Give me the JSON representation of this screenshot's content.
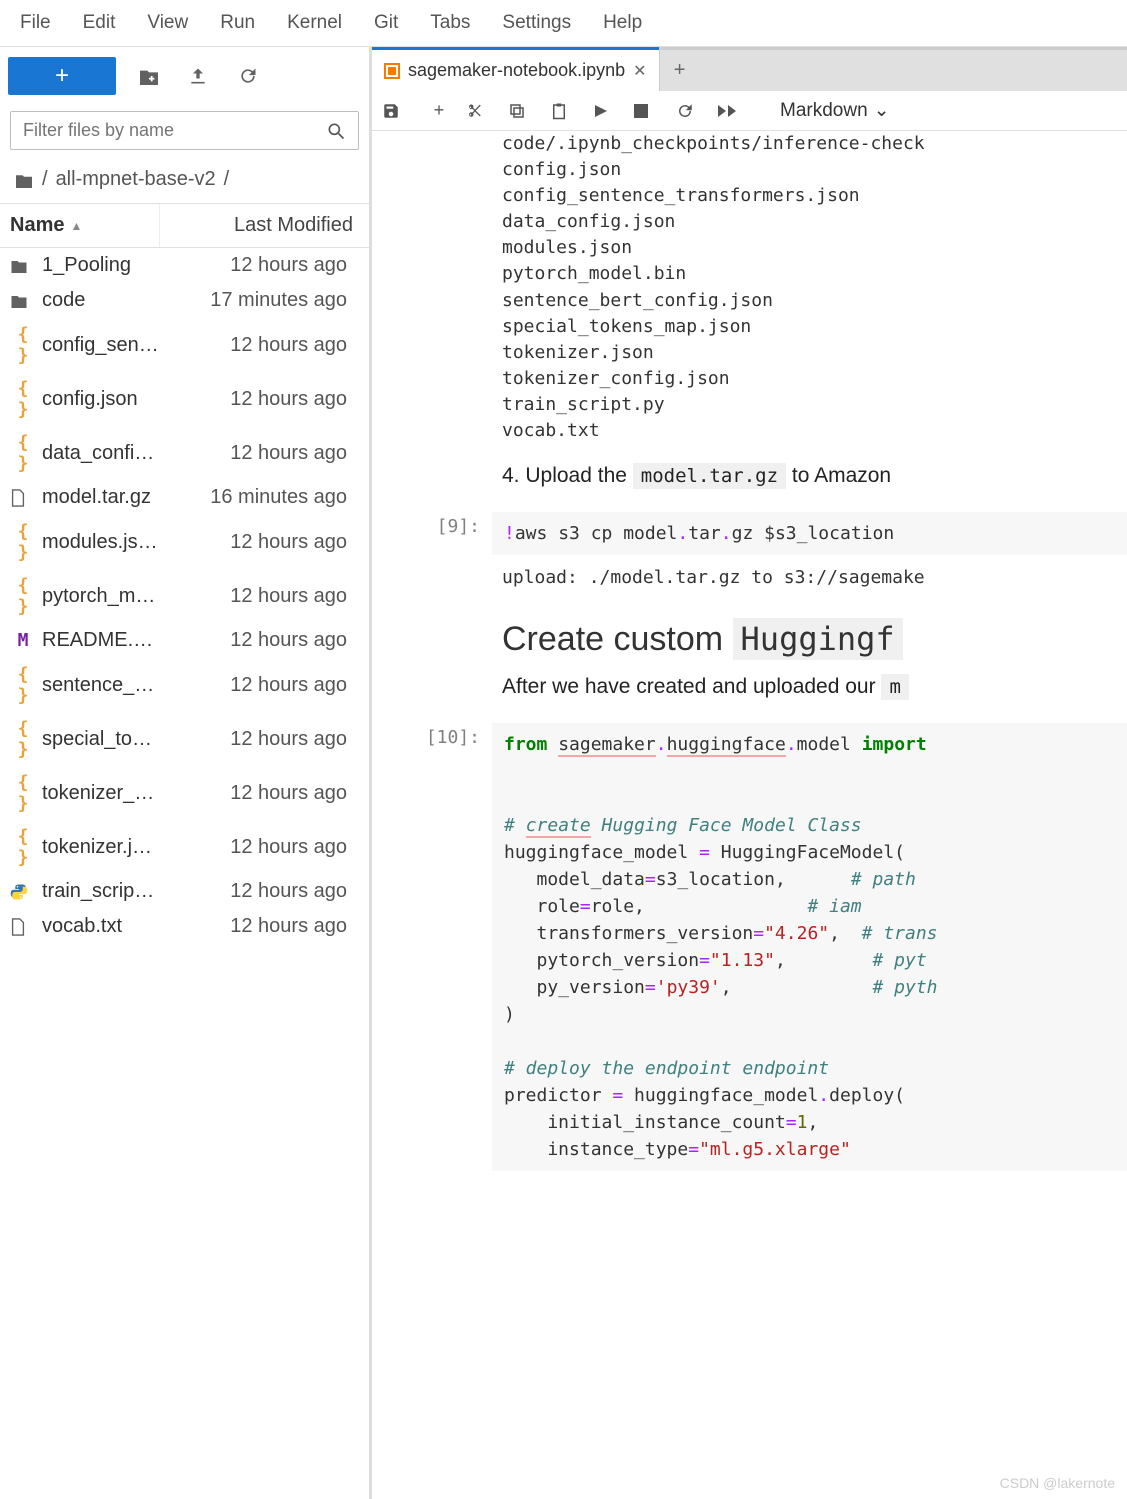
{
  "menubar": [
    "File",
    "Edit",
    "View",
    "Run",
    "Kernel",
    "Git",
    "Tabs",
    "Settings",
    "Help"
  ],
  "sidebar": {
    "filter_placeholder": "Filter files by name",
    "breadcrumb_sep1": "/",
    "breadcrumb_folder": "all-mpnet-base-v2",
    "breadcrumb_sep2": "/",
    "header_name": "Name",
    "header_modified": "Last Modified",
    "files": [
      {
        "icon": "folder",
        "name": "1_Pooling",
        "modified": "12 hours ago"
      },
      {
        "icon": "folder",
        "name": "code",
        "modified": "17 minutes ago"
      },
      {
        "icon": "json",
        "name": "config_sen…",
        "modified": "12 hours ago"
      },
      {
        "icon": "json",
        "name": "config.json",
        "modified": "12 hours ago"
      },
      {
        "icon": "json",
        "name": "data_confi…",
        "modified": "12 hours ago"
      },
      {
        "icon": "file",
        "name": "model.tar.gz",
        "modified": "16 minutes ago"
      },
      {
        "icon": "json",
        "name": "modules.js…",
        "modified": "12 hours ago"
      },
      {
        "icon": "json",
        "name": "pytorch_m…",
        "modified": "12 hours ago"
      },
      {
        "icon": "md",
        "name": "README.…",
        "modified": "12 hours ago"
      },
      {
        "icon": "json",
        "name": "sentence_…",
        "modified": "12 hours ago"
      },
      {
        "icon": "json",
        "name": "special_to…",
        "modified": "12 hours ago"
      },
      {
        "icon": "json",
        "name": "tokenizer_…",
        "modified": "12 hours ago"
      },
      {
        "icon": "json",
        "name": "tokenizer.j…",
        "modified": "12 hours ago"
      },
      {
        "icon": "py",
        "name": "train_scrip…",
        "modified": "12 hours ago"
      },
      {
        "icon": "file",
        "name": "vocab.txt",
        "modified": "12 hours ago"
      }
    ]
  },
  "tab": {
    "title": "sagemaker-notebook.ipynb"
  },
  "nb_toolbar": {
    "celltype": "Markdown"
  },
  "notebook": {
    "output_files": "code/.ipynb_checkpoints/inference-check\nconfig.json\nconfig_sentence_transformers.json\ndata_config.json\nmodules.json\npytorch_model.bin\nsentence_bert_config.json\nspecial_tokens_map.json\ntokenizer.json\ntokenizer_config.json\ntrain_script.py\nvocab.txt",
    "step4_prefix": "4. Upload the ",
    "step4_code": "model.tar.gz",
    "step4_suffix": " to Amazon",
    "cell9_prompt": "[9]:",
    "cell9_code_parts": {
      "bang": "!",
      "cmd": "aws s3 cp model",
      "dot1": ".",
      "tar": "tar",
      "dot2": ".",
      "gz": "gz $s3_location"
    },
    "cell9_output": "upload: ./model.tar.gz to s3://sagemake",
    "heading_prefix": "Create custom ",
    "heading_code": "Huggingf",
    "para_prefix": "After we have created and uploaded our ",
    "para_code": "m",
    "cell10_prompt": "[10]:",
    "code10": {
      "l1_from": "from",
      "l1_mod1": "sagemaker",
      "l1_dot1": ".",
      "l1_mod2": "huggingface",
      "l1_dot2": ".",
      "l1_mod3": "model",
      "l1_import": "import",
      "l3_cmt": "# ",
      "l3_cmt_u": "create",
      "l3_cmt_rest": " Hugging Face Model Class",
      "l4": "huggingface_model ",
      "l4_eq": "=",
      "l4_rest": " HuggingFaceModel(",
      "l5": "   model_data",
      "l5_eq": "=",
      "l5_rest": "s3_location,      ",
      "l5_cmt": "# path",
      "l6": "   role",
      "l6_eq": "=",
      "l6_rest": "role,               ",
      "l6_cmt": "# iam ",
      "l7": "   transformers_version",
      "l7_eq": "=",
      "l7_str": "\"4.26\"",
      "l7_rest": ",  ",
      "l7_cmt": "# trans",
      "l8": "   pytorch_version",
      "l8_eq": "=",
      "l8_str": "\"1.13\"",
      "l8_rest": ",        ",
      "l8_cmt": "# pyt",
      "l9": "   py_version",
      "l9_eq": "=",
      "l9_str": "'py39'",
      "l9_rest": ",             ",
      "l9_cmt": "# pyth",
      "l10": ")",
      "l12_cmt": "# deploy the endpoint endpoint",
      "l13": "predictor ",
      "l13_eq": "=",
      "l13_rest": " huggingface_model",
      "l13_dot": ".",
      "l13_call": "deploy(",
      "l14": "    initial_instance_count",
      "l14_eq": "=",
      "l14_num": "1",
      "l14_rest": ",",
      "l15": "    instance_type",
      "l15_eq": "=",
      "l15_str": "\"ml.g5.xlarge\""
    }
  },
  "watermark": "CSDN @lakernote"
}
